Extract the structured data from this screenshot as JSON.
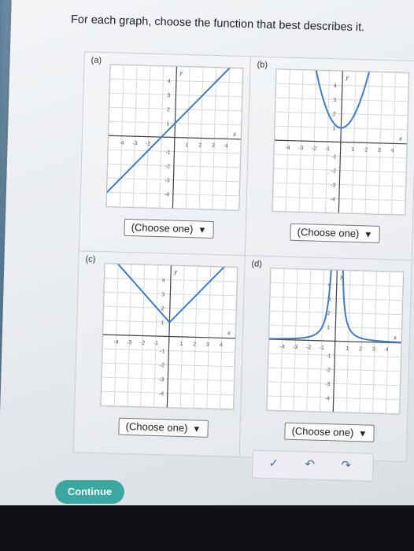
{
  "question": "For each graph, choose the function that best describes it.",
  "graphs": [
    {
      "label": "(a)",
      "select": "(Choose one)",
      "x_ticks": [
        "-4",
        "-3",
        "-2",
        "1",
        "2",
        "3",
        "4"
      ],
      "y_ticks": [
        "4",
        "3",
        "2",
        "1",
        "-1",
        "-2",
        "-3",
        "-4"
      ],
      "xvar": "x",
      "yvar": "y"
    },
    {
      "label": "(b)",
      "select": "(Choose one)",
      "x_ticks": [
        "-4",
        "-3",
        "-2",
        "-1",
        "1",
        "2",
        "3",
        "4"
      ],
      "y_ticks": [
        "4",
        "3",
        "2",
        "1",
        "-1",
        "-2",
        "-3",
        "-4"
      ],
      "xvar": "x",
      "yvar": "y"
    },
    {
      "label": "(c)",
      "select": "(Choose one)",
      "x_ticks": [
        "-4",
        "-3",
        "-2",
        "-1",
        "1",
        "2",
        "3",
        "4"
      ],
      "y_ticks": [
        "4",
        "3",
        "2",
        "1",
        "-1",
        "-2",
        "-3",
        "-4"
      ],
      "xvar": "x",
      "yvar": "y"
    },
    {
      "label": "(d)",
      "select": "(Choose one)",
      "x_ticks": [
        "-4",
        "-3",
        "-2",
        "-1",
        "1",
        "2",
        "3",
        "4"
      ],
      "y_ticks": [
        "4",
        "3",
        "2",
        "1",
        "-1",
        "-2",
        "-3",
        "-4"
      ],
      "xvar": "x",
      "yvar": "y"
    }
  ],
  "dropdown_arrow": "▼",
  "continue_label": "Continue",
  "toolbar_icons": [
    "check-icon",
    "undo-icon",
    "redo-icon"
  ],
  "toolbar_glyphs": [
    "✓",
    "↶",
    "↷"
  ],
  "colors": {
    "curve": "#3f7cc4",
    "continue": "#3aa8a0",
    "grid": "#d5d9de",
    "axis": "#444444"
  }
}
